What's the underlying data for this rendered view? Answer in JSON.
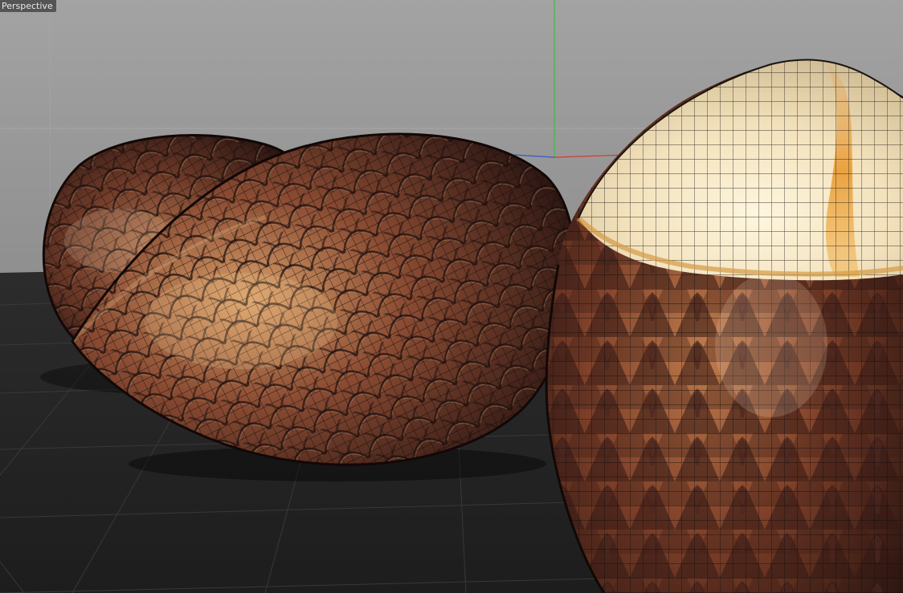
{
  "viewport": {
    "camera_label": "Perspective"
  },
  "colors": {
    "sky_top": "#9c9c9c",
    "sky_bottom": "#7a7a7a",
    "floor": "#252525",
    "floor_grid": "#3a3a3a",
    "axis_x": "#d23a2e",
    "axis_y": "#3fb84a",
    "axis_z": "#3557d6",
    "scale_base": "#7a4430",
    "scale_light": "#c98a55",
    "scale_dark": "#2a1612",
    "cap_light": "#fff4d8",
    "cap_mid": "#e7c78a",
    "cap_stripe": "#e99a2c",
    "wireframe": "#0a0a0a"
  },
  "scene_objects": [
    {
      "name": "salak-fruit-back-left",
      "mesh": "scaled-egg"
    },
    {
      "name": "salak-fruit-middle",
      "mesh": "scaled-egg"
    },
    {
      "name": "salak-fruit-peeled-right",
      "mesh": "half-peeled-dome"
    }
  ],
  "icons": [
    "world-axis-icon",
    "floor-grid-icon"
  ]
}
